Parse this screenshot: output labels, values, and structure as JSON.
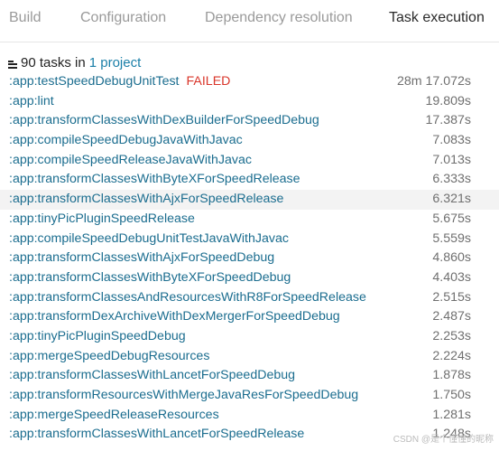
{
  "tabs": [
    {
      "label": "Build"
    },
    {
      "label": "Configuration"
    },
    {
      "label": "Dependency resolution"
    },
    {
      "label": "Task execution",
      "active": true
    }
  ],
  "summary": {
    "icon": "list-icon",
    "prefix": "90 tasks in",
    "link": "1 project"
  },
  "status_color": "#d9352a",
  "link_color": "#1b6d8f",
  "tasks": [
    {
      "name": ":app:testSpeedDebugUnitTest",
      "status": "FAILED",
      "duration": "28m 17.072s"
    },
    {
      "name": ":app:lint",
      "duration": "19.809s"
    },
    {
      "name": ":app:transformClassesWithDexBuilderForSpeedDebug",
      "duration": "17.387s"
    },
    {
      "name": ":app:compileSpeedDebugJavaWithJavac",
      "duration": "7.083s"
    },
    {
      "name": ":app:compileSpeedReleaseJavaWithJavac",
      "duration": "7.013s"
    },
    {
      "name": ":app:transformClassesWithByteXForSpeedRelease",
      "duration": "6.333s"
    },
    {
      "name": ":app:transformClassesWithAjxForSpeedRelease",
      "duration": "6.321s",
      "highlighted": true
    },
    {
      "name": ":app:tinyPicPluginSpeedRelease",
      "duration": "5.675s"
    },
    {
      "name": ":app:compileSpeedDebugUnitTestJavaWithJavac",
      "duration": "5.559s"
    },
    {
      "name": ":app:transformClassesWithAjxForSpeedDebug",
      "duration": "4.860s"
    },
    {
      "name": ":app:transformClassesWithByteXForSpeedDebug",
      "duration": "4.403s"
    },
    {
      "name": ":app:transformClassesAndResourcesWithR8ForSpeedRelease",
      "duration": "2.515s"
    },
    {
      "name": ":app:transformDexArchiveWithDexMergerForSpeedDebug",
      "duration": "2.487s"
    },
    {
      "name": ":app:tinyPicPluginSpeedDebug",
      "duration": "2.253s"
    },
    {
      "name": ":app:mergeSpeedDebugResources",
      "duration": "2.224s"
    },
    {
      "name": ":app:transformClassesWithLancetForSpeedDebug",
      "duration": "1.878s"
    },
    {
      "name": ":app:transformResourcesWithMergeJavaResForSpeedDebug",
      "duration": "1.750s"
    },
    {
      "name": ":app:mergeSpeedReleaseResources",
      "duration": "1.281s"
    },
    {
      "name": ":app:transformClassesWithLancetForSpeedRelease",
      "duration": "1.248s"
    }
  ],
  "watermark": "CSDN @是个懂懂的昵称"
}
